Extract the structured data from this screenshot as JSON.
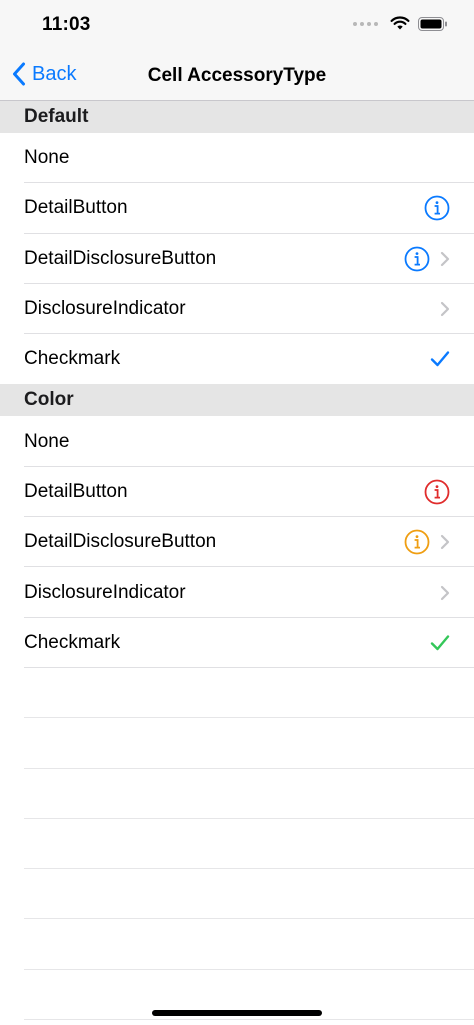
{
  "status_bar": {
    "time": "11:03"
  },
  "nav": {
    "back_label": "Back",
    "title": "Cell AccessoryType"
  },
  "colors": {
    "tint": "#0a7aff",
    "chevron": "#c4c4c7",
    "red": "#e02c2c",
    "orange": "#ef9e12",
    "green": "#34c759"
  },
  "sections": [
    {
      "title": "Default",
      "rows": [
        {
          "label": "None",
          "accessory": "none"
        },
        {
          "label": "DetailButton",
          "accessory": "info-icon"
        },
        {
          "label": "DetailDisclosureButton",
          "accessory": "info-icon + chevron-right-icon"
        },
        {
          "label": "DisclosureIndicator",
          "accessory": "chevron-right-icon"
        },
        {
          "label": "Checkmark",
          "accessory": "checkmark-icon"
        }
      ]
    },
    {
      "title": "Color",
      "rows": [
        {
          "label": "None",
          "accessory": "none"
        },
        {
          "label": "DetailButton",
          "accessory": "info-icon (red)"
        },
        {
          "label": "DetailDisclosureButton",
          "accessory": "info-icon (orange) + chevron-right-icon"
        },
        {
          "label": "DisclosureIndicator",
          "accessory": "chevron-right-icon"
        },
        {
          "label": "Checkmark",
          "accessory": "checkmark-icon (green)"
        }
      ]
    }
  ]
}
